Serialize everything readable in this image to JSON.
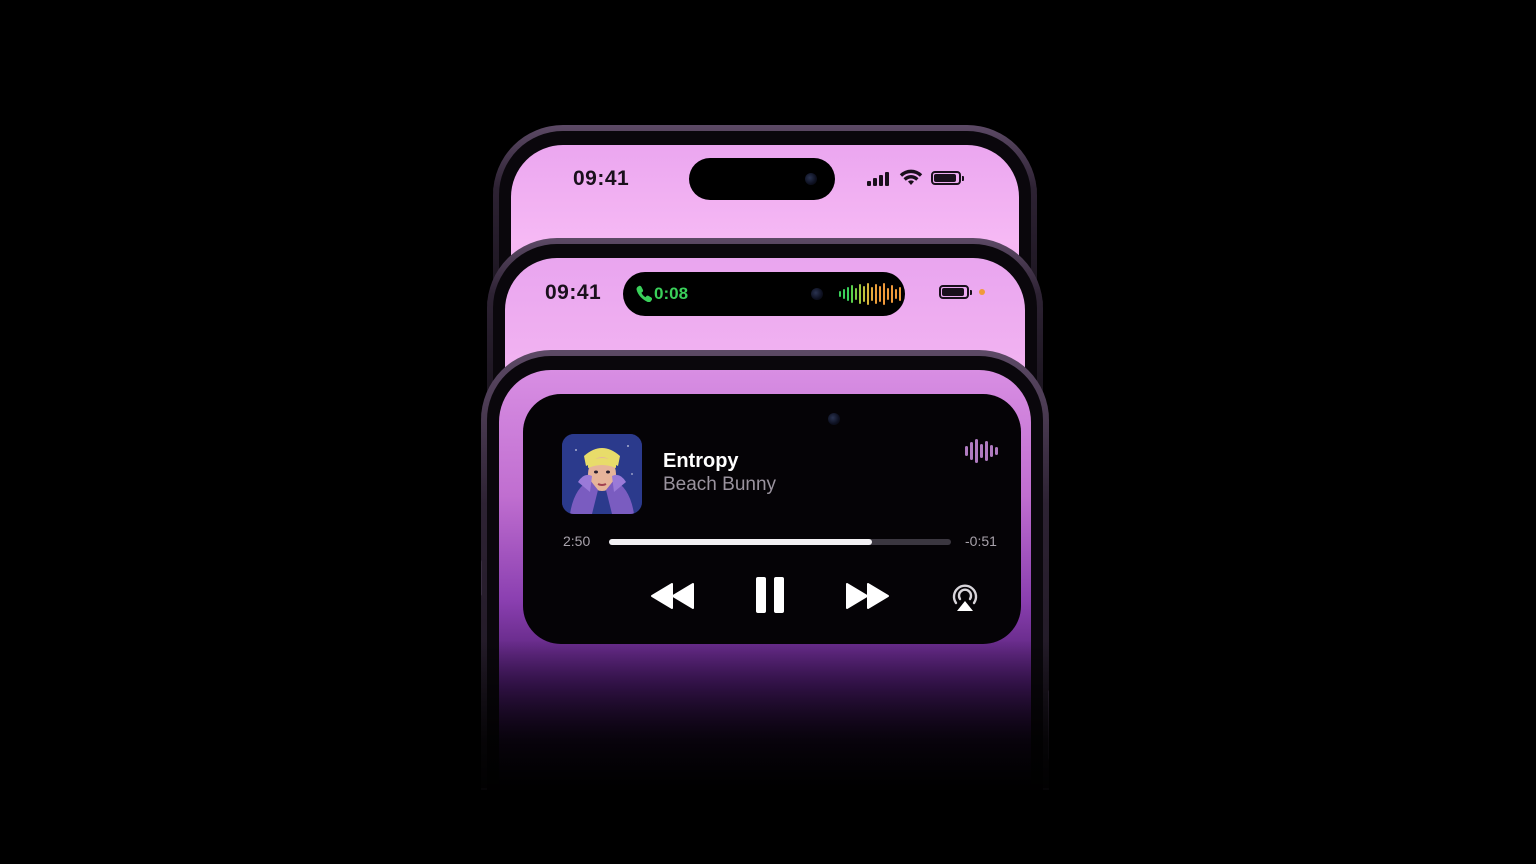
{
  "phones": {
    "back": {
      "time": "09:41",
      "signal_bars": 4,
      "battery_level": 0.85,
      "icons": [
        "signal-icon",
        "wifi-icon",
        "battery-icon"
      ]
    },
    "middle": {
      "time": "09:41",
      "call_duration": "0:08",
      "battery_level": 0.85,
      "call_color": "#3ad05a",
      "icons": [
        "phone-icon",
        "waveform-icon",
        "battery-icon",
        "recording-dot-icon"
      ]
    },
    "front": {
      "now_playing": {
        "title": "Entropy",
        "artist": "Beach Bunny",
        "elapsed": "2:50",
        "remaining": "-0:51",
        "progress": 0.77,
        "controls": [
          "rewind-icon",
          "pause-icon",
          "fast-forward-icon",
          "airplay-icon"
        ]
      }
    }
  },
  "colors": {
    "background": "#000000",
    "screen_pink": "#f4b7f2",
    "deep_purple": "#8a3fb0",
    "call_green": "#3ad05a",
    "wave_orange": "#f09a3a"
  }
}
